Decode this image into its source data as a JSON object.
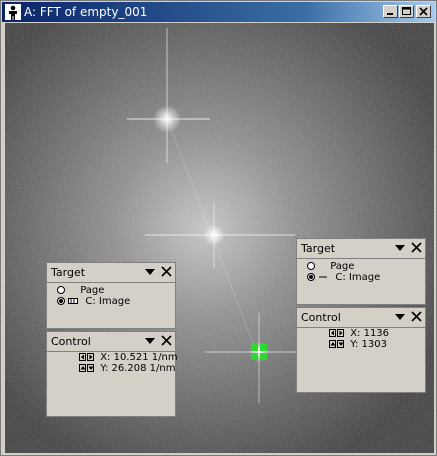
{
  "window": {
    "title": "A: FFT of empty_001"
  },
  "palettes": [
    {
      "title": "Target",
      "options": [
        {
          "label": "Page",
          "selected": false
        },
        {
          "label": "C: Image",
          "selected": true
        }
      ]
    },
    {
      "title": "Control",
      "readouts": [
        {
          "label": "X: 10.521 1/nm"
        },
        {
          "label": "Y: 26.208 1/nm"
        }
      ]
    },
    {
      "title": "Target",
      "options": [
        {
          "label": "Page",
          "selected": false
        },
        {
          "label": "C: Image",
          "selected": true
        }
      ]
    },
    {
      "title": "Control",
      "readouts": [
        {
          "label": "X: 1136"
        },
        {
          "label": "Y: 1303"
        }
      ]
    }
  ],
  "colors": {
    "titlebar_start": "#0a246a",
    "titlebar_end": "#a6caf0",
    "marker": "#2bd82b",
    "panel": "#d4d0c8"
  },
  "icons": {
    "app": "figure-icon",
    "minimize": "minimize-icon",
    "maximize": "maximize-icon",
    "close": "close-icon"
  }
}
